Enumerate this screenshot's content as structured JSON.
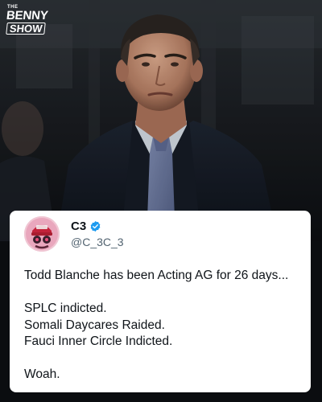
{
  "logo": {
    "the": "THE",
    "benny": "BENNY",
    "show": "SHOW"
  },
  "photo": {
    "subject": "man in dark suit and tie"
  },
  "post": {
    "display_name": "C3",
    "verified": true,
    "handle": "@C_3C_3",
    "avatar_icon": "avatar-image",
    "lines": [
      "Todd Blanche has been Acting AG for 26 days...",
      "SPLC indicted.",
      "Somali Daycares Raided.",
      "Fauci Inner Circle Indicted.",
      "Woah."
    ]
  },
  "colors": {
    "verified_blue": "#1d9bf0",
    "text_primary": "#0f1419",
    "text_secondary": "#536471",
    "card_background": "#ffffff",
    "page_background": "#0b0d10"
  }
}
